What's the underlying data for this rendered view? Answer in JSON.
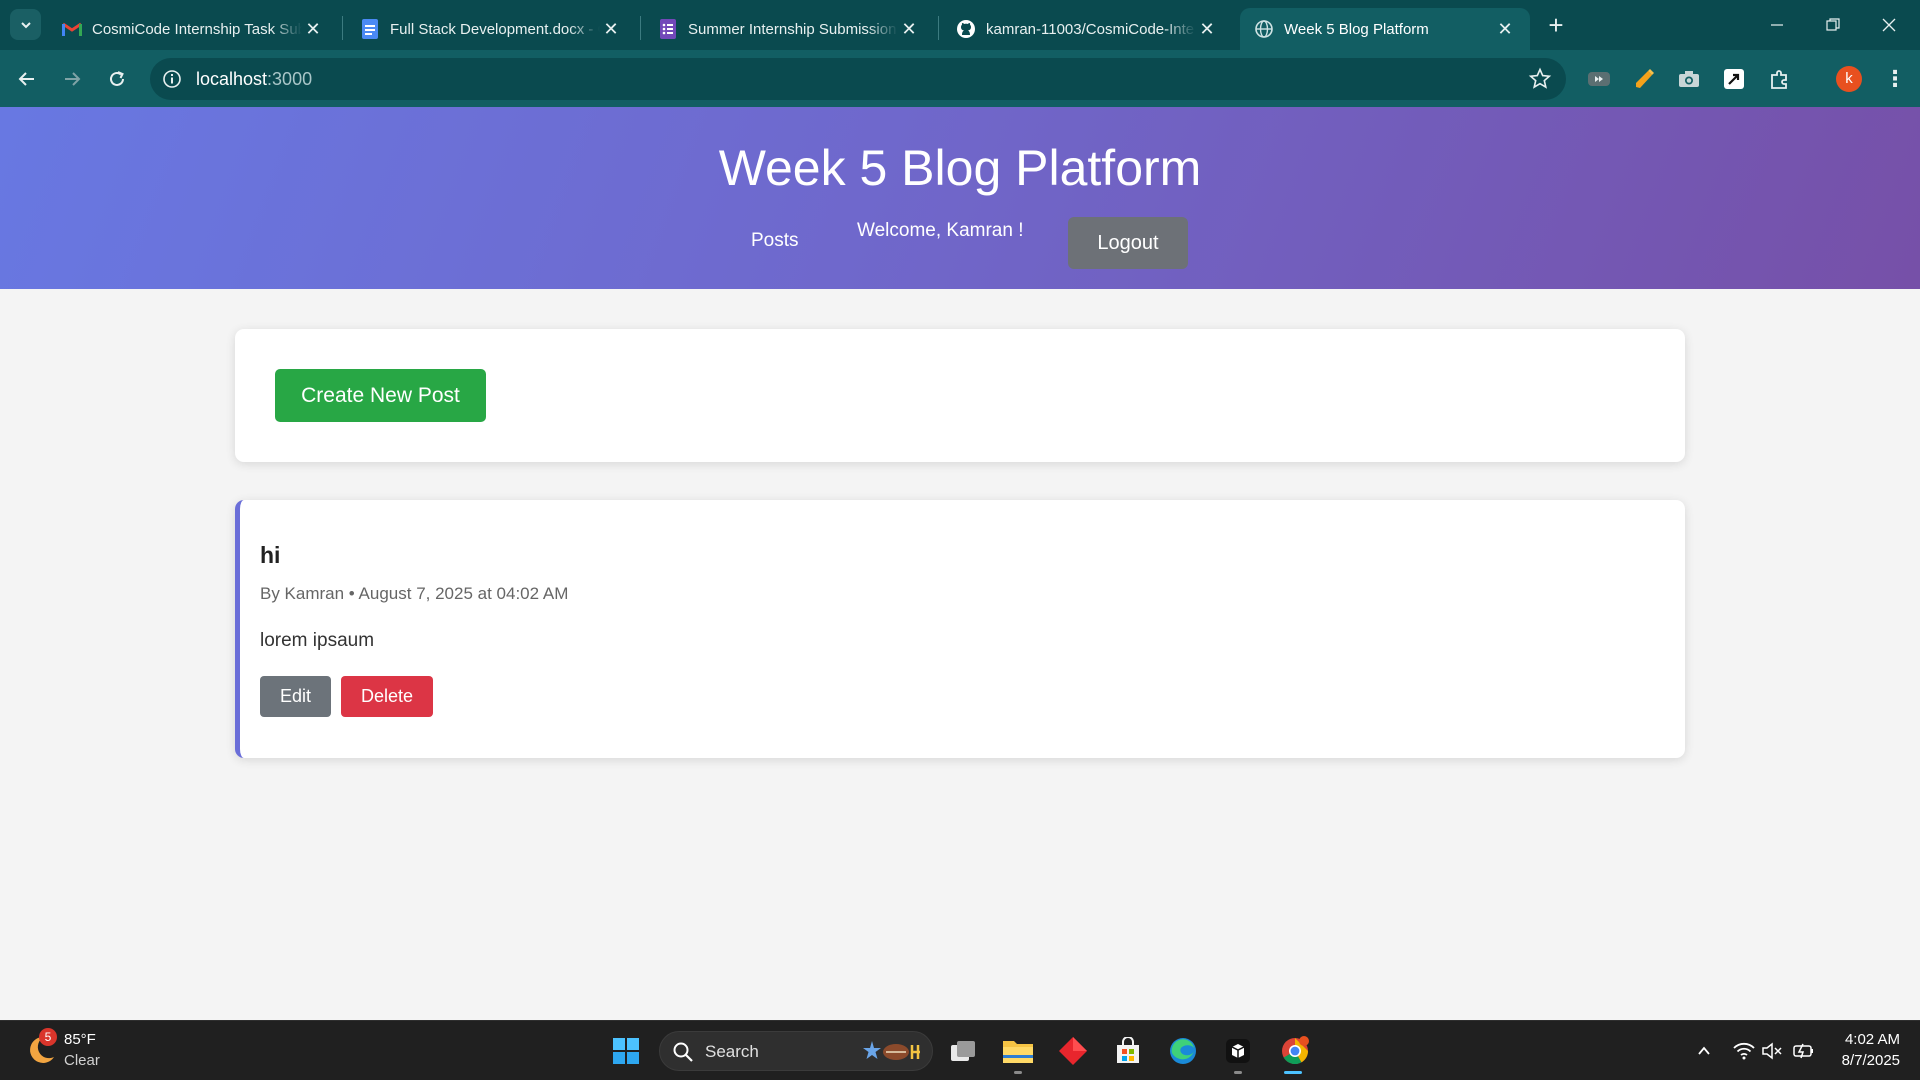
{
  "browser": {
    "tabs": [
      {
        "label": "CosmiCode Internship Task Sub",
        "icon": "gmail-icon"
      },
      {
        "label": "Full Stack Development.docx - G",
        "icon": "docs-icon"
      },
      {
        "label": "Summer Internship Submission",
        "icon": "forms-icon"
      },
      {
        "label": "kamran-11003/CosmiCode-Inte",
        "icon": "github-icon"
      },
      {
        "label": "Week 5 Blog Platform",
        "icon": "globe-icon",
        "active": true
      }
    ],
    "url_host": "localhost",
    "url_port": ":3000",
    "profile_initial": "k"
  },
  "site": {
    "title": "Week 5 Blog Platform",
    "nav_posts": "Posts",
    "welcome": "Welcome, Kamran !",
    "logout": "Logout"
  },
  "actions": {
    "create_new_post": "Create New Post"
  },
  "post": {
    "title": "hi",
    "meta": "By Kamran • August 7, 2025 at 04:02 AM",
    "body": "lorem ipsaum",
    "edit": "Edit",
    "delete": "Delete"
  },
  "taskbar": {
    "weather_badge": "5",
    "weather_temp": "85°F",
    "weather_cond": "Clear",
    "search_label": "Search",
    "time": "4:02 AM",
    "date": "8/7/2025"
  },
  "colors": {
    "header_gradient_start": "#6878e2",
    "header_gradient_end": "#7650a8",
    "create_button": "#28a745",
    "delete_button": "#dc3545",
    "edit_button": "#6c737a",
    "logout_button": "#6d7177",
    "post_accent_border": "#6a6ed8"
  }
}
